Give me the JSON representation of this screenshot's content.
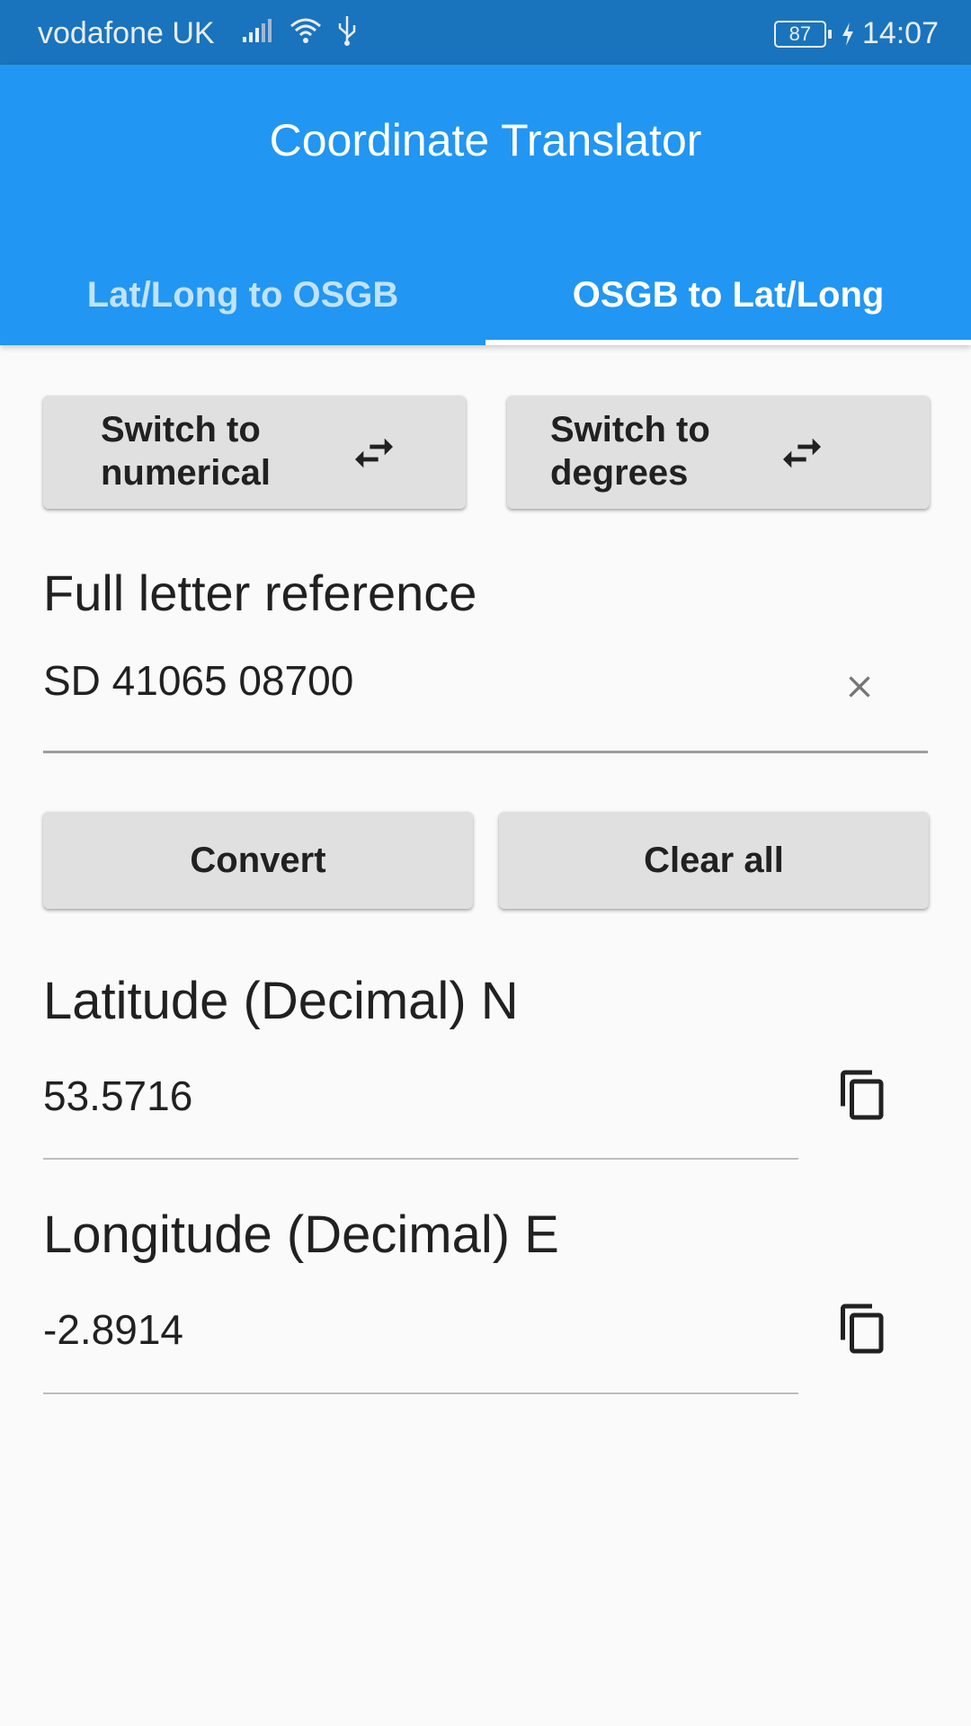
{
  "status_bar": {
    "carrier": "vodafone UK",
    "battery": "87",
    "time": "14:07",
    "icons": [
      "signal-icon",
      "wifi-icon",
      "usb-icon",
      "battery-icon",
      "charging-icon"
    ]
  },
  "app_bar": {
    "title": "Coordinate Translator",
    "tabs": [
      {
        "label": "Lat/Long to OSGB",
        "selected": false
      },
      {
        "label": "OSGB to Lat/Long",
        "selected": true
      }
    ]
  },
  "switch_buttons": {
    "numerical": {
      "line1": "Switch to",
      "line2": "numerical",
      "icon": "swap-horiz-icon"
    },
    "degrees": {
      "line1": "Switch to",
      "line2": "degrees",
      "icon": "swap-horiz-icon"
    }
  },
  "input": {
    "label": "Full letter reference",
    "value": "SD 41065 08700",
    "clear_icon": "close-icon"
  },
  "actions": {
    "convert": "Convert",
    "clear_all": "Clear all"
  },
  "results": {
    "latitude": {
      "label": "Latitude (Decimal) N",
      "value": "53.5716",
      "icon": "copy-icon"
    },
    "longitude": {
      "label": "Longitude (Decimal) E",
      "value": "-2.8914",
      "icon": "copy-icon"
    }
  },
  "colors": {
    "status_bar": "#1a73bd",
    "app_bar": "#2196f3",
    "background": "#fafafa",
    "button": "#e0e0e0"
  }
}
